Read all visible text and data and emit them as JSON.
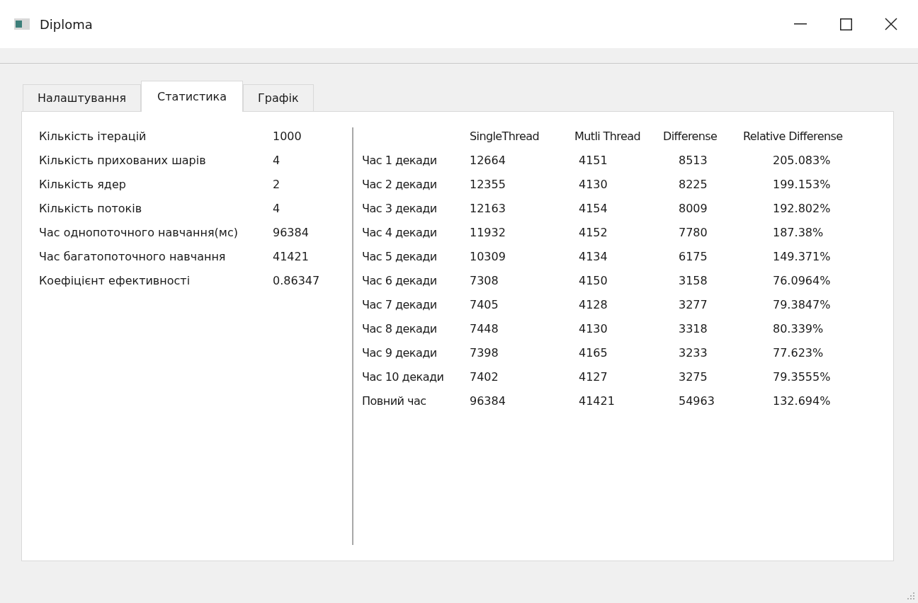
{
  "window": {
    "title": "Diploma"
  },
  "tabs": [
    {
      "label": "Налаштування",
      "selected": false
    },
    {
      "label": "Статистика",
      "selected": true
    },
    {
      "label": "Графік",
      "selected": false
    }
  ],
  "stats": [
    {
      "label": "Кількість ітерацій",
      "value": "1000"
    },
    {
      "label": "Кількість прихованих шарів",
      "value": "4"
    },
    {
      "label": "Кількість ядер",
      "value": "2"
    },
    {
      "label": "Кількість потоків",
      "value": "4"
    },
    {
      "label": "Час однопоточного навчання(мс)",
      "value": "96384"
    },
    {
      "label": "Час багатопоточного навчання",
      "value": "41421"
    },
    {
      "label": "Коефіцієнт ефективності",
      "value": "0.86347"
    }
  ],
  "table": {
    "columns": [
      "SingleThread",
      "Mutli Thread",
      "Differense",
      "Relative Differense"
    ],
    "rows": [
      {
        "label": "Час 1 декади",
        "values": [
          "12664",
          "4151",
          "8513",
          "205.083%"
        ]
      },
      {
        "label": "Час 2 декади",
        "values": [
          "12355",
          "4130",
          "8225",
          "199.153%"
        ]
      },
      {
        "label": "Час 3 декади",
        "values": [
          "12163",
          "4154",
          "8009",
          "192.802%"
        ]
      },
      {
        "label": "Час 4 декади",
        "values": [
          "11932",
          "4152",
          "7780",
          "187.38%"
        ]
      },
      {
        "label": "Час 5 декади",
        "values": [
          "10309",
          "4134",
          "6175",
          "149.371%"
        ]
      },
      {
        "label": "Час 6 декади",
        "values": [
          "7308",
          "4150",
          "3158",
          "76.0964%"
        ]
      },
      {
        "label": "Час 7 декади",
        "values": [
          "7405",
          "4128",
          "3277",
          "79.3847%"
        ]
      },
      {
        "label": "Час 8 декади",
        "values": [
          "7448",
          "4130",
          "3318",
          "80.339%"
        ]
      },
      {
        "label": "Час 9 декади",
        "values": [
          "7398",
          "4165",
          "3233",
          "77.623%"
        ]
      },
      {
        "label": "Час 10 декади",
        "values": [
          "7402",
          "4127",
          "3275",
          "79.3555%"
        ]
      },
      {
        "label": "Повний час",
        "values": [
          "96384",
          "41421",
          "54963",
          "132.694%"
        ]
      }
    ]
  }
}
